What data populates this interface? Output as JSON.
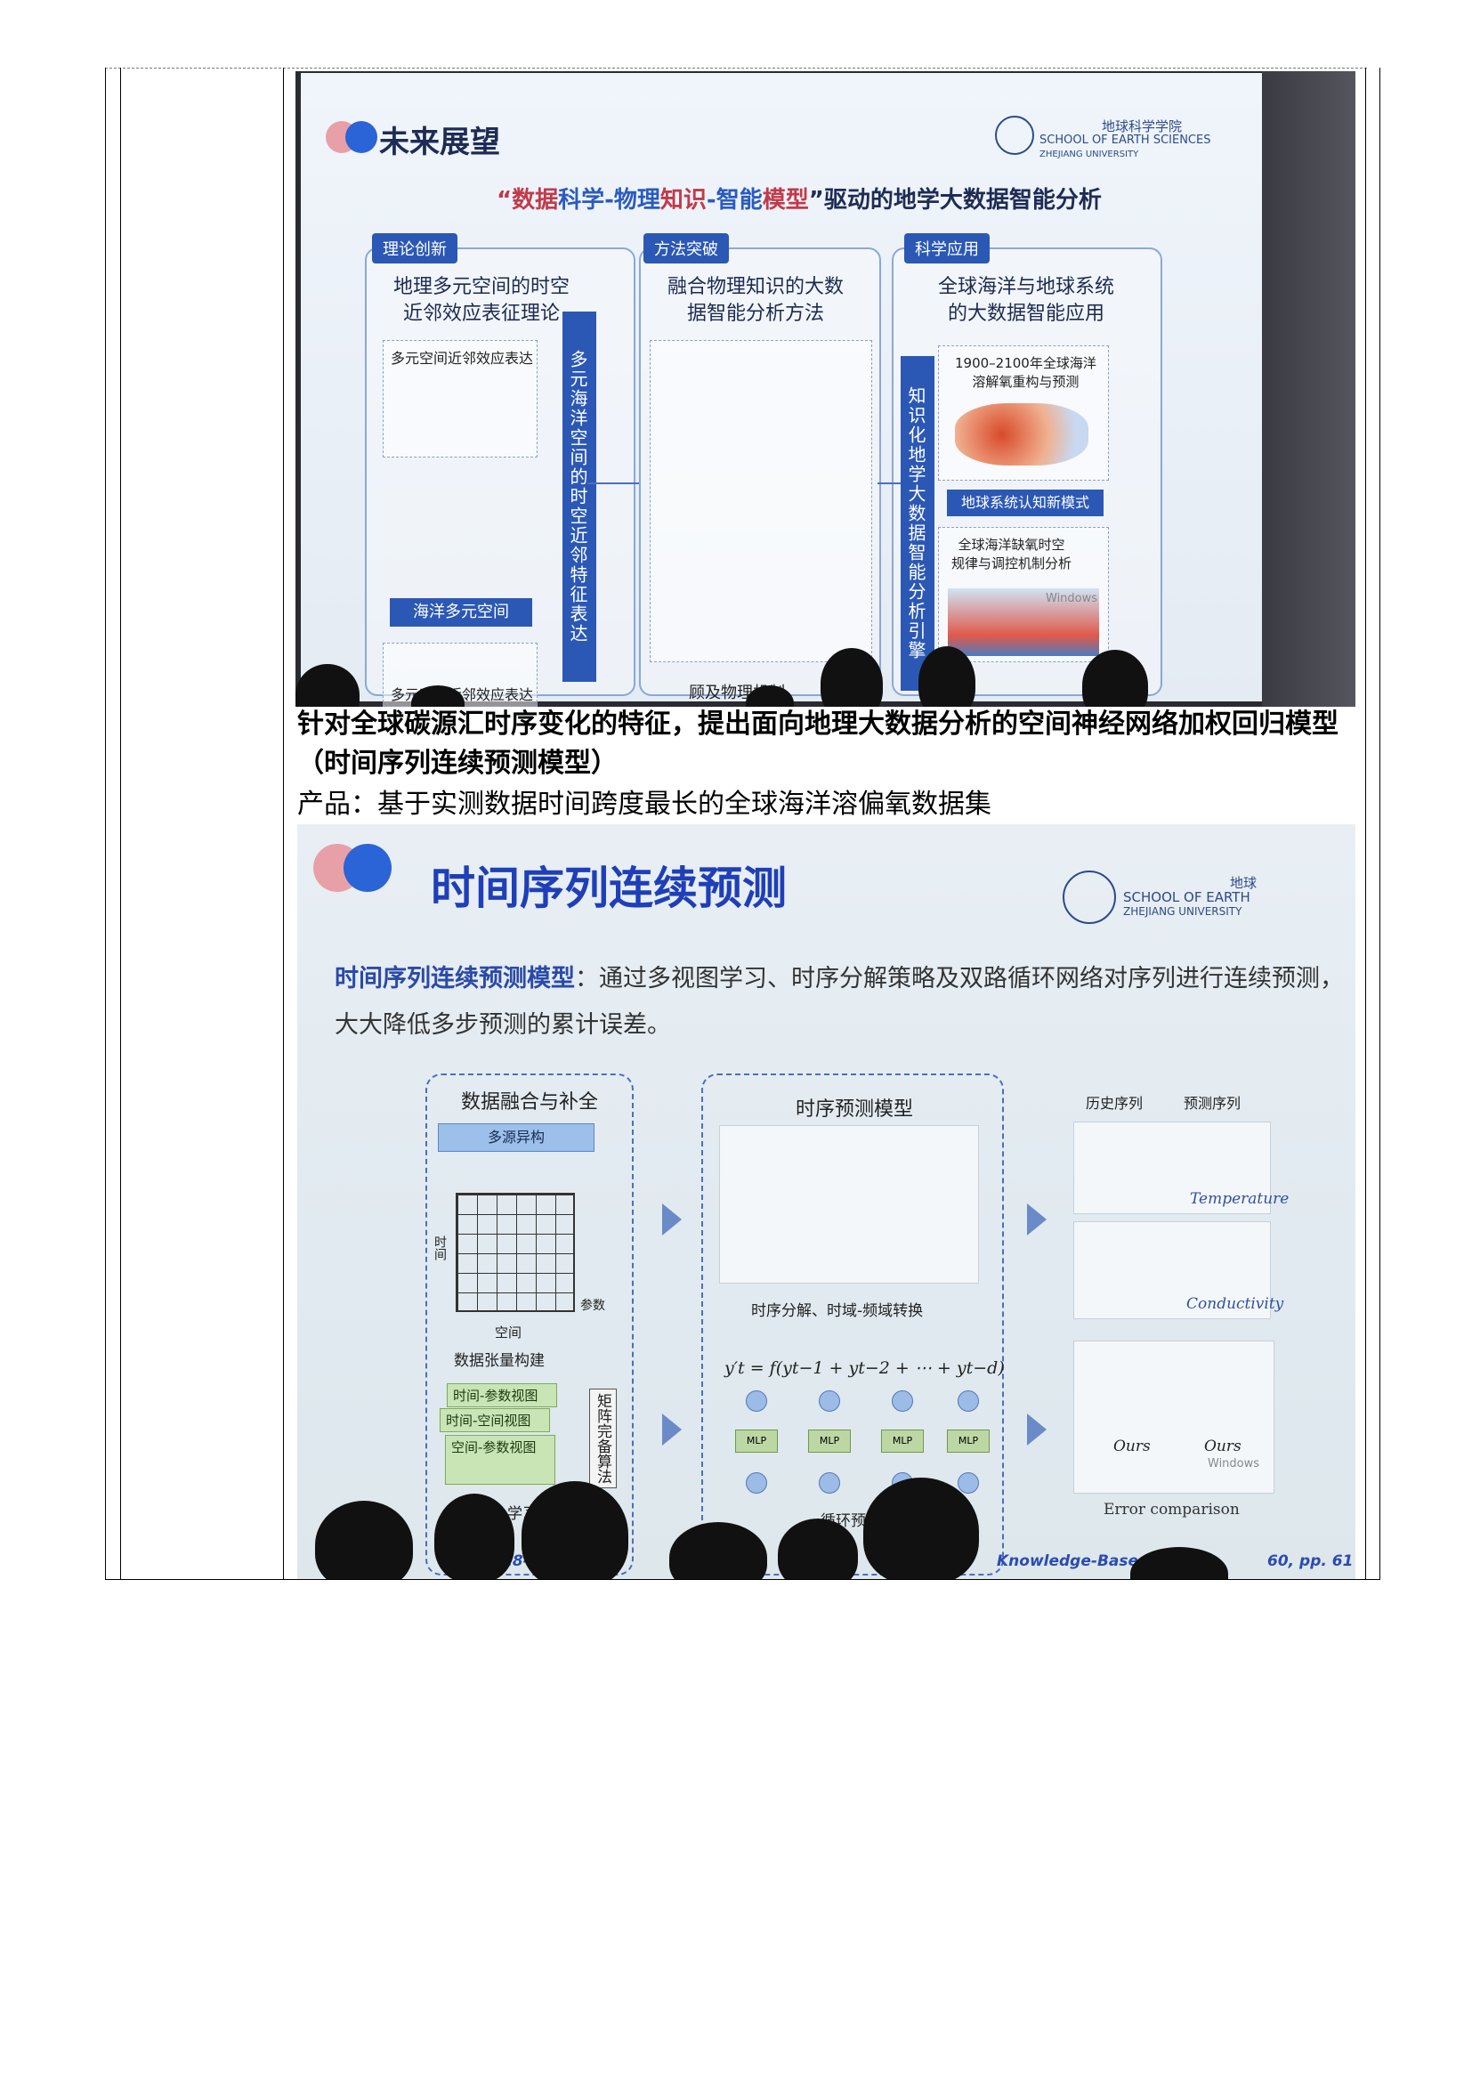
{
  "photo1": {
    "slide_title": "未来展望",
    "school_cn": "地球科学学院",
    "school_en_1": "SCHOOL OF EARTH SCIENCES",
    "school_en_2": "ZHEJIANG UNIVERSITY",
    "subtitle_open": "“",
    "subtitle_part1": "数据",
    "subtitle_part2": "科学-物理",
    "subtitle_part3": "知识",
    "subtitle_part4": "-智能",
    "subtitle_part5": "模型",
    "subtitle_part6": "”驱动的地学大数据智能分析",
    "col1": {
      "tag": "理论创新",
      "heading_1": "地理多元空间的时空",
      "heading_2": "近邻效应表征理论",
      "box1_label": "多元空间近邻效应表达",
      "bar_h": "海洋多元空间",
      "box2_label": "多元时间近邻效应表达",
      "bar_v": "多元海洋空间的时空近邻特征表达"
    },
    "col2": {
      "tag": "方法突破",
      "heading_1": "融合物理知识的大数",
      "heading_2": "据智能分析方法",
      "caption": "顾及物理机制"
    },
    "col3": {
      "tag": "科学应用",
      "heading_1": "全球海洋与地球系统",
      "heading_2": "的大数据智能应用",
      "bar_v": "知识化地学大数据智能分析引擎",
      "box1_1": "1900–2100年全球海洋",
      "box1_2": "溶解氧重构与预测",
      "bar_h": "地球系统认知新模式",
      "box2_1": "全球海洋缺氧时空",
      "box2_2": "规律与调控机制分析",
      "watermark": "Windows"
    }
  },
  "text": {
    "bold_line": "针对全球碳源汇时序变化的特征，提出面向地理大数据分析的空间神经网络加权回归模型（时间序列连续预测模型）",
    "product_line": "产品：基于实测数据时间跨度最长的全球海洋溶偏氧数据集"
  },
  "photo2": {
    "slide_title": "时间序列连续预测",
    "school_cn": "地球",
    "school_en_1": "SCHOOL OF EARTH",
    "school_en_2": "ZHEJIANG UNIVERSITY",
    "desc_bold": "时间序列连续预测模型",
    "desc_rest": "：通过多视图学习、时序分解策略及双路循环网络对序列进行连续预测，大大降低多步预测的累计误差。",
    "panel1": {
      "title": "数据融合与补全",
      "source": "多源异构",
      "axis_time": "时间",
      "axis_space": "空间",
      "axis_param": "参数",
      "tensor": "数据张量构建",
      "view1": "时间-参数视图",
      "view2": "时间-空间视图",
      "view3": "空间-参数视图",
      "algo": "矩阵完备算法",
      "bottom": "学习"
    },
    "panel2": {
      "title": "时序预测模型",
      "decomp": "时序分解、时域-频域转换",
      "formula": "y′t = f(yt−1 + yt−2 + ⋯ + yt−d)",
      "mlp": "MLP",
      "bottom": "循环预"
    },
    "panel3": {
      "hist": "历史序列",
      "pred": "预测序列",
      "temp": "Temperature",
      "cond": "Conductivity",
      "ours": "Ours",
      "error": "Error comparison",
      "watermark": "Windows"
    },
    "cite_left": "18-30, 201",
    "cite_right": "Knowledge-Based",
    "cite_right2": "60, pp. 61"
  },
  "colors": {
    "accent_blue": "#2b58b5",
    "title_blue": "#1e3fb8",
    "red": "#c23a4a"
  }
}
